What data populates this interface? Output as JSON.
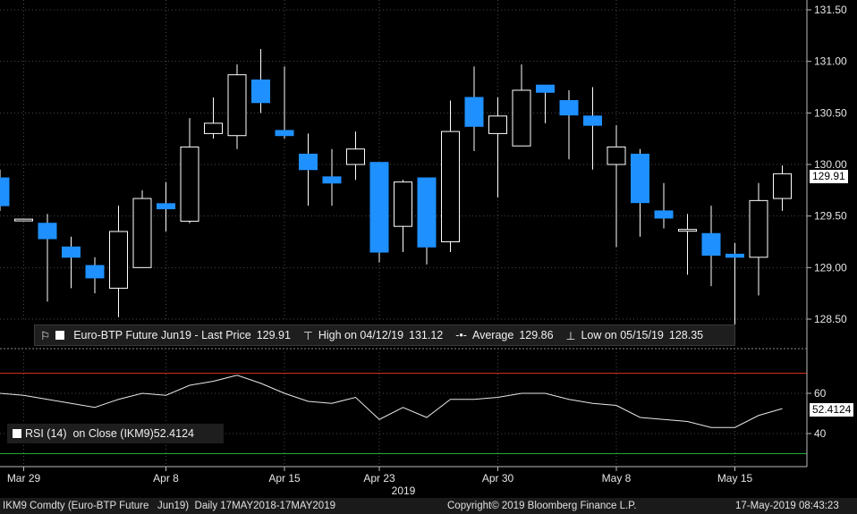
{
  "legend": {
    "series_label": "Euro-BTP Future Jun19 - Last Price",
    "last_price": "129.91",
    "high_label": "High on 04/12/19",
    "high_value": "131.12",
    "average_label": "Average",
    "average_value": "129.86",
    "low_label": "Low on 05/15/19",
    "low_value": "128.35"
  },
  "rsi_legend": {
    "label": "RSI (14)  on Close (IKM9)",
    "value": "52.4124"
  },
  "price_tag": "129.91",
  "rsi_tag": "52.4124",
  "footer": {
    "ticker": "IKM9 Comdty (Euro-BTP Future   Jun19)  Daily 17MAY2018-17MAY2019",
    "copyright": "Copyright© 2019 Bloomberg Finance L.P.",
    "timestamp": "17-May-2019 08:43:23"
  },
  "colors": {
    "up": "#000000",
    "down": "#1e90ff",
    "rsi_upper": "#d12b1e",
    "rsi_lower": "#1fa83a"
  },
  "chart_data": [
    {
      "type": "candlestick",
      "ylim": [
        128.35,
        131.6
      ],
      "yticks": [
        128.5,
        129.0,
        129.5,
        130.0,
        130.5,
        131.0,
        131.5
      ],
      "ytick_labels": [
        "128.50",
        "129.00",
        "129.50",
        "130.00",
        "130.50",
        "131.00",
        "131.50"
      ],
      "xtick_labels": [
        {
          "label": "Mar 29",
          "index": 1
        },
        {
          "label": "Apr 8",
          "index": 7
        },
        {
          "label": "Apr 15",
          "index": 12
        },
        {
          "label": "Apr 23",
          "index": 16
        },
        {
          "label": "Apr 30",
          "index": 21
        },
        {
          "label": "May 8",
          "index": 26
        },
        {
          "label": "May 15",
          "index": 31
        }
      ],
      "year_label": "2019",
      "candles": [
        {
          "o": 129.87,
          "h": 129.95,
          "l": 129.55,
          "c": 129.6
        },
        {
          "o": 129.47,
          "h": 129.47,
          "l": 129.47,
          "c": 129.47
        },
        {
          "o": 129.43,
          "h": 129.52,
          "l": 128.67,
          "c": 129.28
        },
        {
          "o": 129.2,
          "h": 129.3,
          "l": 128.8,
          "c": 129.1
        },
        {
          "o": 129.02,
          "h": 129.1,
          "l": 128.75,
          "c": 128.9
        },
        {
          "o": 128.8,
          "h": 129.6,
          "l": 128.52,
          "c": 129.35
        },
        {
          "o": 129.0,
          "h": 129.75,
          "l": 129.0,
          "c": 129.67
        },
        {
          "o": 129.62,
          "h": 129.83,
          "l": 129.35,
          "c": 129.57
        },
        {
          "o": 129.45,
          "h": 130.45,
          "l": 129.43,
          "c": 130.17
        },
        {
          "o": 130.3,
          "h": 130.65,
          "l": 130.25,
          "c": 130.4
        },
        {
          "o": 130.28,
          "h": 130.97,
          "l": 130.15,
          "c": 130.87
        },
        {
          "o": 130.82,
          "h": 131.12,
          "l": 130.5,
          "c": 130.6
        },
        {
          "o": 130.33,
          "h": 130.95,
          "l": 130.25,
          "c": 130.28
        },
        {
          "o": 130.1,
          "h": 130.3,
          "l": 129.6,
          "c": 129.95
        },
        {
          "o": 129.88,
          "h": 130.15,
          "l": 129.6,
          "c": 129.82
        },
        {
          "o": 130.0,
          "h": 130.32,
          "l": 129.85,
          "c": 130.15
        },
        {
          "o": 130.02,
          "h": 130.02,
          "l": 129.05,
          "c": 129.15
        },
        {
          "o": 129.4,
          "h": 129.85,
          "l": 129.15,
          "c": 129.83
        },
        {
          "o": 129.87,
          "h": 129.87,
          "l": 129.03,
          "c": 129.2
        },
        {
          "o": 129.25,
          "h": 130.62,
          "l": 129.15,
          "c": 130.32
        },
        {
          "o": 130.65,
          "h": 130.95,
          "l": 130.13,
          "c": 130.37
        },
        {
          "o": 130.3,
          "h": 130.65,
          "l": 129.68,
          "c": 130.47
        },
        {
          "o": 130.18,
          "h": 130.97,
          "l": 130.18,
          "c": 130.72
        },
        {
          "o": 130.77,
          "h": 130.77,
          "l": 130.4,
          "c": 130.7
        },
        {
          "o": 130.62,
          "h": 130.72,
          "l": 130.05,
          "c": 130.48
        },
        {
          "o": 130.47,
          "h": 130.75,
          "l": 129.95,
          "c": 130.38
        },
        {
          "o": 130.0,
          "h": 130.38,
          "l": 129.2,
          "c": 130.17
        },
        {
          "o": 130.1,
          "h": 130.15,
          "l": 129.3,
          "c": 129.63
        },
        {
          "o": 129.55,
          "h": 129.82,
          "l": 129.38,
          "c": 129.48
        },
        {
          "o": 129.37,
          "h": 129.52,
          "l": 128.93,
          "c": 129.37
        },
        {
          "o": 129.33,
          "h": 129.6,
          "l": 128.82,
          "c": 129.12
        },
        {
          "o": 129.13,
          "h": 129.24,
          "l": 128.35,
          "c": 129.1
        },
        {
          "o": 129.1,
          "h": 129.82,
          "l": 128.73,
          "c": 129.65
        },
        {
          "o": 129.67,
          "h": 129.99,
          "l": 129.55,
          "c": 129.91
        }
      ]
    },
    {
      "type": "line",
      "name": "RSI (14)",
      "ylim": [
        20,
        82
      ],
      "yticks": [
        40,
        60
      ],
      "ytick_labels": [
        "40",
        "60"
      ],
      "upper_band": 70,
      "lower_band": 30,
      "values": [
        60,
        59,
        57,
        55,
        53,
        57,
        60,
        59,
        64,
        66,
        69,
        65,
        60,
        56,
        55,
        58,
        47,
        53,
        48,
        57,
        57,
        58,
        60,
        60,
        57,
        55,
        54,
        48,
        47,
        46,
        43,
        43,
        49,
        52.4
      ]
    }
  ]
}
